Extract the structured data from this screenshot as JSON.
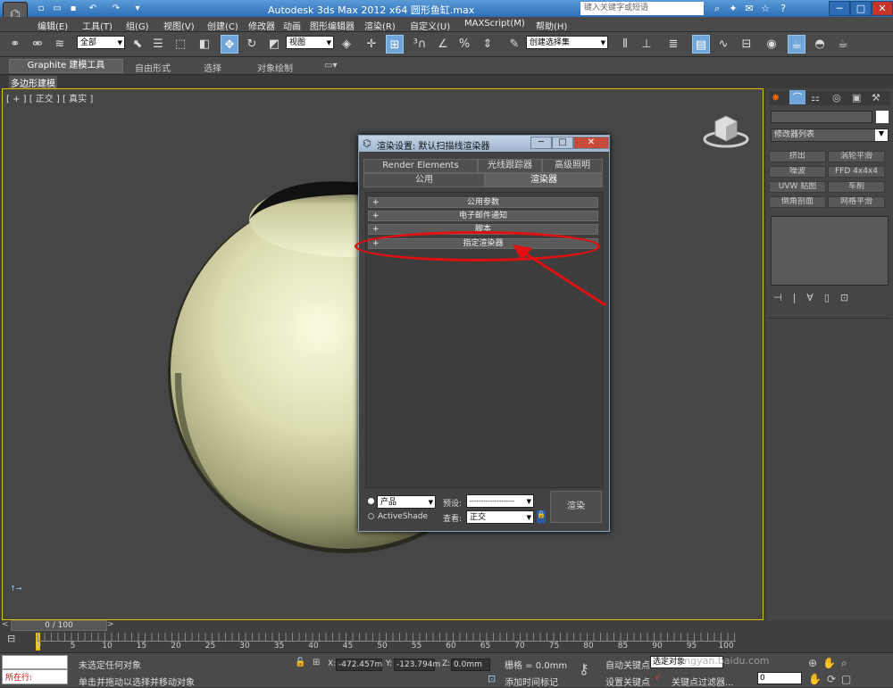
{
  "titlebar": {
    "title": "Autodesk 3ds Max  2012 x64      圆形鱼缸.max",
    "search_placeholder": "键入关键字或短语"
  },
  "menu": [
    "编辑(E)",
    "工具(T)",
    "组(G)",
    "视图(V)",
    "创建(C)",
    "修改器",
    "动画",
    "图形编辑器",
    "渲染(R)",
    "自定义(U)",
    "MAXScript(M)",
    "帮助(H)"
  ],
  "toolbar": {
    "filter": "全部",
    "view_select": "视图",
    "selection_set": "创建选择集"
  },
  "ribbon": {
    "tabs": [
      "Graphite 建模工具",
      "自由形式",
      "选择",
      "对象绘制"
    ],
    "sub": "多边形建模"
  },
  "viewport": {
    "label": "[ + ] [ 正交 ] [ 真实 ]"
  },
  "command_panel": {
    "modifier_list": "修改器列表",
    "buttons": [
      "挤出",
      "涡轮平滑",
      "噪波",
      "FFD 4x4x4",
      "UVW 贴图",
      "车削",
      "倒角剖面",
      "网格平滑"
    ]
  },
  "dialog": {
    "title": "渲染设置: 默认扫描线渲染器",
    "tabs_row1": [
      "Render Elements",
      "光线跟踪器",
      "高级照明"
    ],
    "tabs_row2": [
      "公用",
      "渲染器"
    ],
    "rollouts": [
      "公用参数",
      "电子邮件通知",
      "脚本",
      "指定渲染器"
    ],
    "mode_product": "产品",
    "mode_activeshade": "ActiveShade",
    "preset_label": "预设:",
    "preset_value": "--------------------",
    "view_label": "查看:",
    "view_value": "正交",
    "render_button": "渲染"
  },
  "timeline": {
    "slider": "0 / 100",
    "ticks": [
      "0",
      "5",
      "10",
      "15",
      "20",
      "25",
      "30",
      "35",
      "40",
      "45",
      "50",
      "55",
      "60",
      "65",
      "70",
      "75",
      "80",
      "85",
      "90",
      "95",
      "100"
    ]
  },
  "status": {
    "script_label": "所在行:",
    "selection": "未选定任何对象",
    "prompt": "单击并拖动以选择并移动对象",
    "x": "-472.457m",
    "y": "-123.794m",
    "z": "0.0mm",
    "grid": "栅格 = 0.0mm",
    "auto_key": "自动关键点",
    "selected": "选定对象",
    "set_key": "设置关键点",
    "key_filter": "关键点过滤器...",
    "add_time_tag": "添加时间标记",
    "frame": "0",
    "watermark": "jingyan.baidu.com"
  },
  "colors": {
    "accent": "#e6c000",
    "highlight": "#e01010"
  }
}
